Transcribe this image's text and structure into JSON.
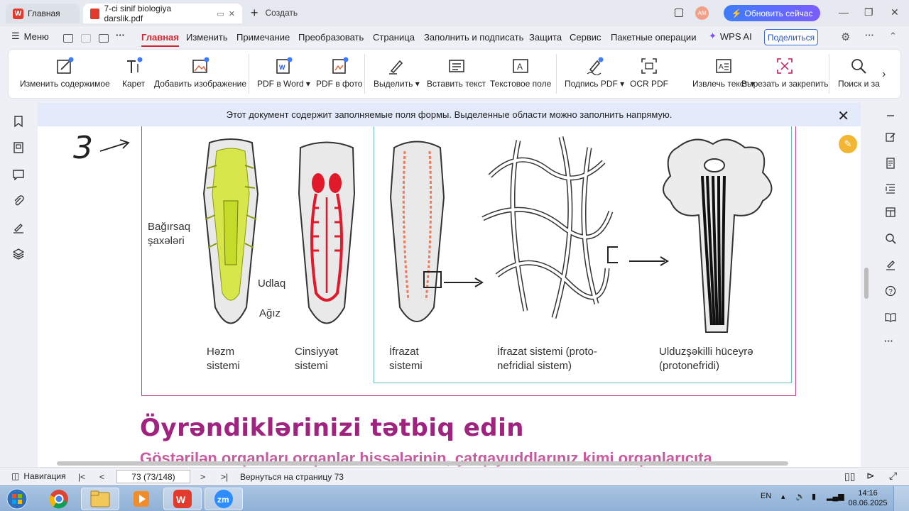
{
  "tabs": {
    "home_label": "Главная",
    "doc_label": "7-ci sinif biologiya darslik.pdf",
    "new_label": "Создать"
  },
  "titlebar": {
    "avatar_initials": "AM",
    "upgrade_label": "Обновить сейчас"
  },
  "menu": {
    "menu_label": "Меню",
    "items": [
      "Главная",
      "Изменить",
      "Примечание",
      "Преобразовать",
      "Страница",
      "Заполнить и подписать",
      "Защита",
      "Сервис",
      "Пакетные операции"
    ],
    "wps_ai": "WPS AI",
    "share": "Поделиться"
  },
  "ribbon": {
    "buttons": [
      "Изменить содержимое",
      "Карет",
      "Добавить изображение",
      "PDF в Word",
      "PDF в фото",
      "Выделить",
      "Вставить текст",
      "Текстовое поле",
      "Подпись PDF",
      "OCR PDF",
      "Извлечь текст",
      "Вырезать и закрепить",
      "Поиск и за"
    ]
  },
  "notice": {
    "text": "Этот документ содержит заполняемые поля формы. Выделенные области можно заполнить напрямую."
  },
  "figure": {
    "handwritten": "3",
    "label_bagirsaq": "Bağırsaq\nşaxələri",
    "label_udlaq": "Udlaq",
    "label_agiz": "Ağız",
    "caption_hazm": "Həzm\nsistemi",
    "caption_cinsiyyat": "Cinsiyyət\nsistemi",
    "caption_ifrazat": "İfrazat\nsistemi",
    "caption_ifrazat_sistemi": "İfrazat sistemi (proto-\nnefridial sistem)",
    "caption_ulduz": "Ulduzşəkilli hüceyrə\n(protonefridi)"
  },
  "document": {
    "heading": "Öyrəndiklərinizi tətbiq edin",
    "subtext": "Göstərilən orqanları orqanlar hissələrinin, çatqayuddlarınız kimi orqanlarıcıta"
  },
  "status": {
    "nav_label": "Навигация",
    "page_box": "73 (73/148)",
    "return_label": "Вернуться на страницу 73"
  },
  "taskbar": {
    "lang": "EN",
    "time": "14:16",
    "date": "08.06.2025"
  },
  "colors": {
    "accent": "#d8262f",
    "heading": "#a0237f",
    "frame": "#b6478a",
    "teal": "#6fbcb4"
  }
}
